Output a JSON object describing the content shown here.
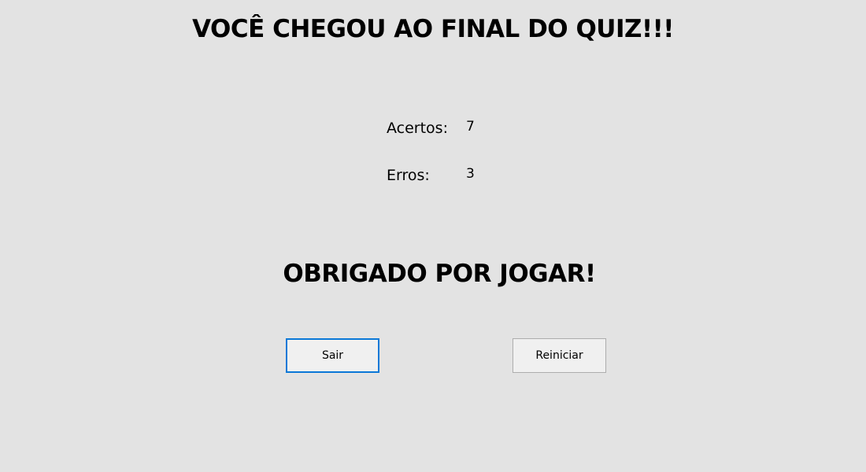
{
  "header": {
    "title": "VOCÊ CHEGOU AO FINAL DO QUIZ!!!"
  },
  "results": {
    "correct_label": "Acertos:",
    "correct_value": "7",
    "errors_label": "Erros:",
    "errors_value": "3"
  },
  "footer": {
    "thanks_message": "OBRIGADO POR JOGAR!"
  },
  "buttons": {
    "exit_label": "Sair",
    "restart_label": "Reiniciar"
  },
  "colors": {
    "background": "#e3e3e3",
    "button_background": "#f0f0f0",
    "focus_border": "#0a78d7",
    "button_border": "#adadad"
  }
}
